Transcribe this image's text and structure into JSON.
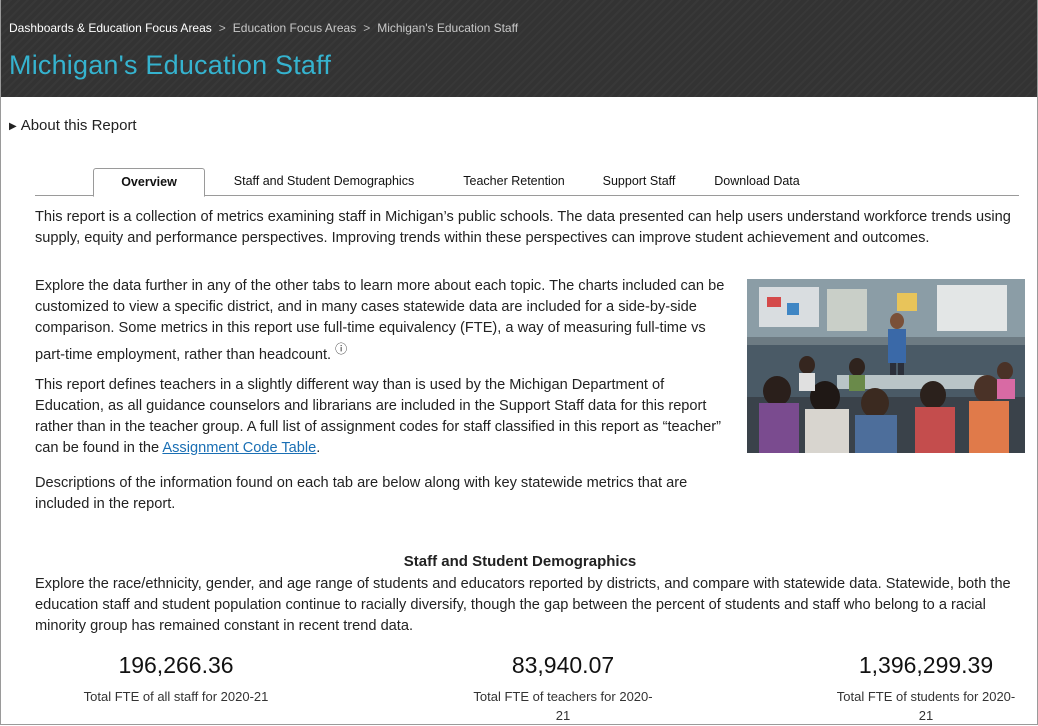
{
  "breadcrumb": {
    "items": [
      "Dashboards & Education Focus Areas",
      "Education Focus Areas",
      "Michigan's Education Staff"
    ],
    "separator": ">"
  },
  "page": {
    "title": "Michigan's Education Staff"
  },
  "about": {
    "label": "About this Report"
  },
  "tabs": [
    {
      "label": "Overview",
      "active": true
    },
    {
      "label": "Staff and Student Demographics",
      "active": false
    },
    {
      "label": "Teacher Retention",
      "active": false
    },
    {
      "label": "Support Staff",
      "active": false
    },
    {
      "label": "Download Data",
      "active": false
    }
  ],
  "overview": {
    "p1": "This report is a collection of metrics examining staff in Michigan’s public schools. The data presented can help users understand workforce trends using supply, equity and performance perspectives. Improving trends within these perspectives can improve student achievement and outcomes.",
    "p2": "Explore the data further in any of the other tabs to learn more about each topic. The charts included can be customized to view a specific district, and in many cases statewide data are included for a side-by-side comparison. Some metrics in this report use full-time equivalency (FTE), a way of measuring full-time vs part-time employment, rather than headcount.",
    "p3_before": "This report defines teachers in a slightly different way than is used by the Michigan Department of Education, as all guidance counselors and librarians are included in the Support Staff data for this report rather than in the teacher group. A full list of assignment codes for staff classified in this report as “teacher” can be found in the ",
    "p3_link": "Assignment Code Table",
    "p3_after": ".",
    "p4": "Descriptions of the information found on each tab are below along with key statewide metrics that are included in the report."
  },
  "section": {
    "title": "Staff and Student Demographics",
    "description": "Explore the race/ethnicity, gender, and age range of students and educators reported by districts, and compare with statewide data. Statewide, both the education staff and student population continue to racially diversify, though the gap between the percent of students and staff who belong to a racial minority group has remained constant in recent trend data."
  },
  "metrics": [
    {
      "value": "196,266.36",
      "label": "Total FTE of all staff for 2020-21"
    },
    {
      "value": "83,940.07",
      "label": "Total FTE of teachers for 2020-21"
    },
    {
      "value": "1,396,299.39",
      "label": "Total FTE of students for 2020-21"
    }
  ]
}
